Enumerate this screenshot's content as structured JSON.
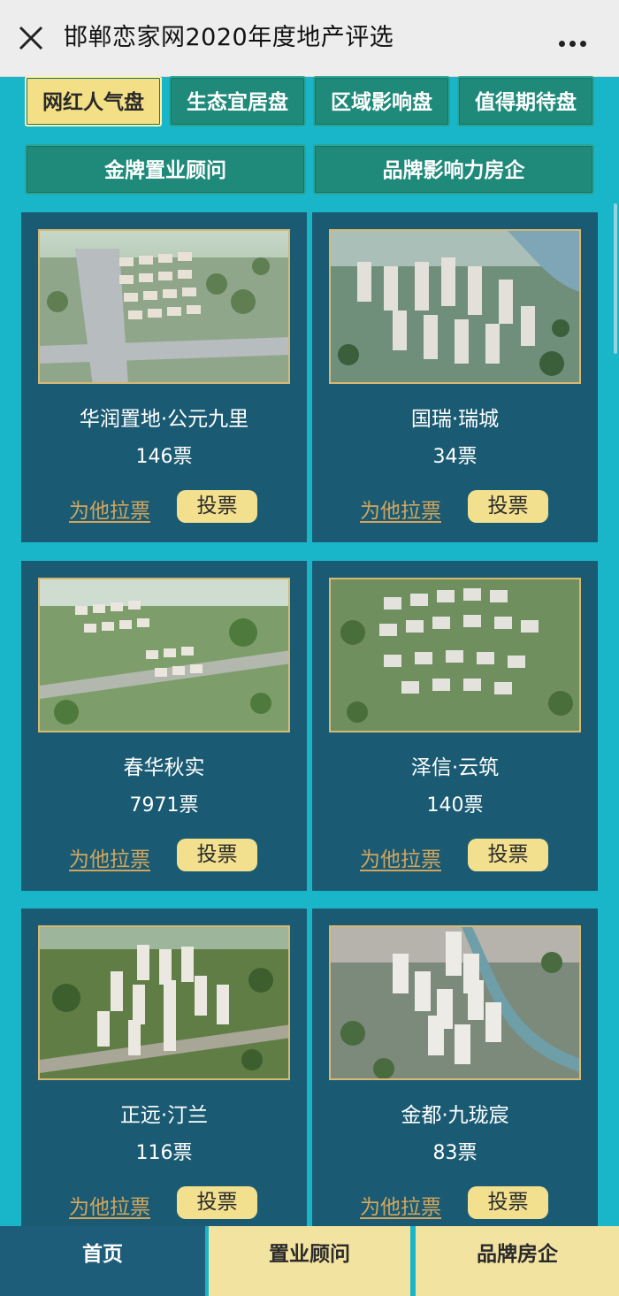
{
  "header": {
    "title": "邯郸恋家网2020年度地产评选"
  },
  "tabs": [
    {
      "label": "网红人气盘",
      "active": true
    },
    {
      "label": "生态宜居盘",
      "active": false
    },
    {
      "label": "区域影响盘",
      "active": false
    },
    {
      "label": "值得期待盘",
      "active": false
    },
    {
      "label": "金牌置业顾问",
      "active": false
    },
    {
      "label": "品牌影响力房企",
      "active": false
    }
  ],
  "cards": [
    {
      "name": "华润置地·公元九里",
      "votes": "146票",
      "canvass_label": "为他拉票",
      "vote_label": "投票",
      "photo": "aerial-render-1"
    },
    {
      "name": "国瑞·瑞城",
      "votes": "34票",
      "canvass_label": "为他拉票",
      "vote_label": "投票",
      "photo": "aerial-render-2"
    },
    {
      "name": "春华秋实",
      "votes": "7971票",
      "canvass_label": "为他拉票",
      "vote_label": "投票",
      "photo": "aerial-render-3"
    },
    {
      "name": "泽信·云筑",
      "votes": "140票",
      "canvass_label": "为他拉票",
      "vote_label": "投票",
      "photo": "aerial-render-4"
    },
    {
      "name": "正远·汀兰",
      "votes": "116票",
      "canvass_label": "为他拉票",
      "vote_label": "投票",
      "photo": "aerial-render-5"
    },
    {
      "name": "金都·九珑宸",
      "votes": "83票",
      "canvass_label": "为他拉票",
      "vote_label": "投票",
      "photo": "aerial-render-6"
    }
  ],
  "bottom_nav": [
    {
      "label": "首页",
      "active": true
    },
    {
      "label": "置业顾问",
      "active": false
    },
    {
      "label": "品牌房企",
      "active": false
    }
  ],
  "colors": {
    "page_bg": "#19b6c9",
    "card_bg": "#1a5b73",
    "tab_bg": "#1f8a7a",
    "tab_active_bg": "#f2df86",
    "vote_button_bg": "#f2e08e",
    "canvass_link": "#d3a45d",
    "nav_active_bg": "#1e5d79",
    "nav_bg": "#f3e3a0"
  }
}
